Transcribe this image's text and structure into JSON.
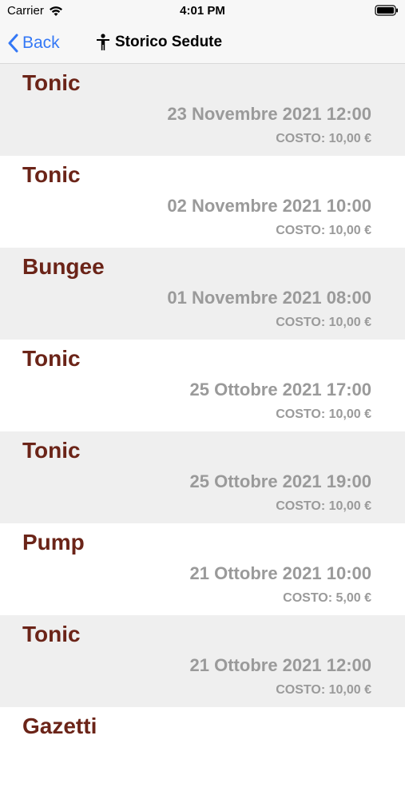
{
  "status_bar": {
    "carrier": "Carrier",
    "time": "4:01 PM",
    "wifi_icon": "wifi-icon",
    "battery_icon": "battery-icon"
  },
  "nav": {
    "back_label": "Back",
    "back_icon": "chevron-left-icon",
    "title": "Storico Sedute",
    "title_icon": "person-icon",
    "accent_color": "#3478f6"
  },
  "sessions": [
    {
      "name": "Tonic",
      "datetime": "23 Novembre 2021 12:00",
      "cost": "COSTO: 10,00 €"
    },
    {
      "name": "Tonic",
      "datetime": "02 Novembre 2021 10:00",
      "cost": "COSTO: 10,00 €"
    },
    {
      "name": "Bungee",
      "datetime": "01 Novembre 2021 08:00",
      "cost": "COSTO: 10,00 €"
    },
    {
      "name": "Tonic",
      "datetime": "25 Ottobre 2021 17:00",
      "cost": "COSTO: 10,00 €"
    },
    {
      "name": "Tonic",
      "datetime": "25 Ottobre 2021 19:00",
      "cost": "COSTO: 10,00 €"
    },
    {
      "name": "Pump",
      "datetime": "21 Ottobre 2021 10:00",
      "cost": "COSTO: 5,00 €"
    },
    {
      "name": "Tonic",
      "datetime": "21 Ottobre 2021 12:00",
      "cost": "COSTO: 10,00 €"
    },
    {
      "name": "Gazetti",
      "datetime": "",
      "cost": ""
    }
  ],
  "colors": {
    "title_text": "#6b2418",
    "secondary_text": "#9a9a9a",
    "shaded_row": "#efefef",
    "plain_row": "#ffffff"
  }
}
